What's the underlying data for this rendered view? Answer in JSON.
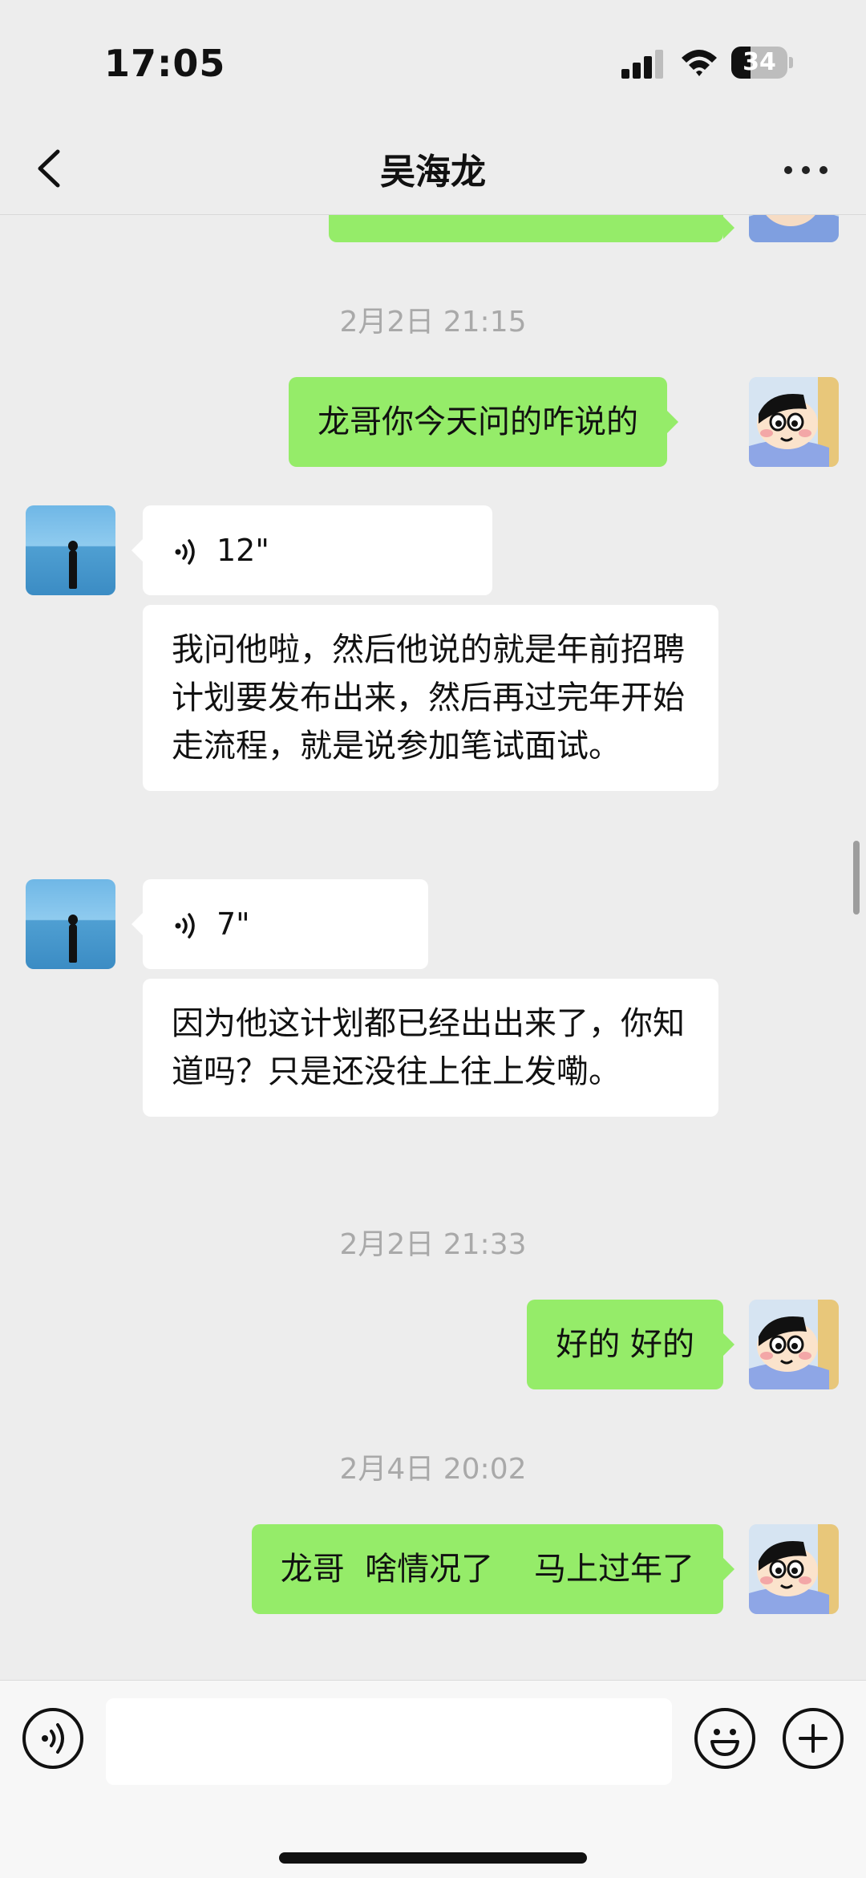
{
  "status_bar": {
    "time": "17:05",
    "battery_level": "34",
    "battery_fraction": 0.34
  },
  "header": {
    "title": "吴海龙",
    "back_icon": "chevron-left-icon",
    "more_icon": "more-dots-icon"
  },
  "messages": [
    {
      "kind": "timestamp",
      "text": "2月2日 21:15"
    },
    {
      "kind": "text",
      "from": "me",
      "text": "龙哥你今天问的咋说的"
    },
    {
      "kind": "voice",
      "from": "contact",
      "duration": "12\""
    },
    {
      "kind": "text",
      "from": "contact",
      "text": "我问他啦，然后他说的就是年前招聘计划要发布出来，然后再过完年开始走流程，就是说参加笔试面试。"
    },
    {
      "kind": "voice",
      "from": "contact",
      "duration": "7\""
    },
    {
      "kind": "text",
      "from": "contact",
      "text": "因为他这计划都已经出出来了，你知道吗？只是还没往上往上发嘞。"
    },
    {
      "kind": "timestamp",
      "text": "2月2日 21:33"
    },
    {
      "kind": "text",
      "from": "me",
      "text": "好的 好的"
    },
    {
      "kind": "timestamp",
      "text": "2月4日 20:02"
    },
    {
      "kind": "text",
      "from": "me",
      "text": "龙哥  啥情况了    马上过年了"
    }
  ],
  "input_bar": {
    "value": "",
    "voice_icon": "voice-mode-icon",
    "emoji_icon": "emoji-icon",
    "plus_icon": "plus-icon"
  },
  "colors": {
    "me_bubble": "#95ec69",
    "contact_bubble": "#ffffff",
    "background": "#ededed",
    "timestamp": "#a9a9a9"
  }
}
